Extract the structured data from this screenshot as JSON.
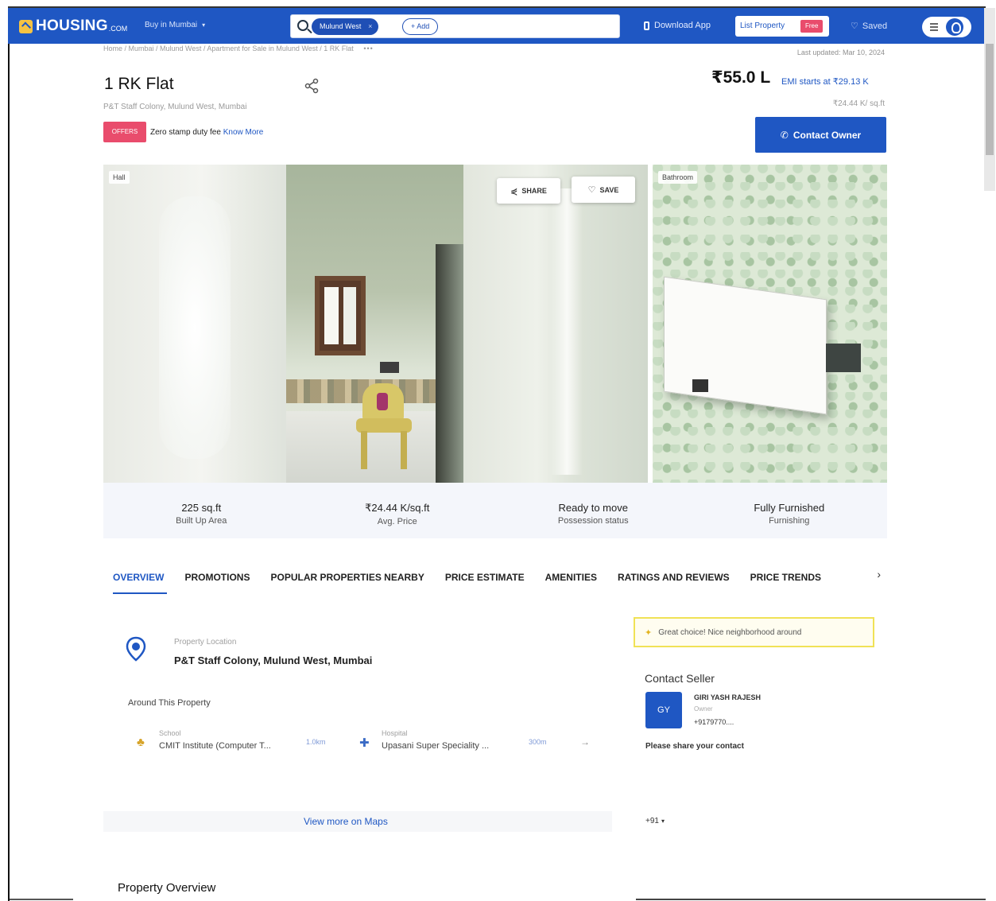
{
  "header": {
    "logo": "HOUSING",
    "logo_suffix": ".COM",
    "city_select": "Buy in Mumbai",
    "search_chip": "Mulund West",
    "search_chip_close": "×",
    "add_chip": "+ Add",
    "download_app": "Download App",
    "list_property": "List Property",
    "free_badge": "Free",
    "saved": "Saved",
    "brand_color": "#1f57c3"
  },
  "breadcrumb": {
    "path": "Home / Mumbai / Mulund West / Apartment for Sale in Mulund West / 1 RK Flat",
    "more": "•••",
    "last_updated": "Last updated: Mar 10, 2024"
  },
  "property": {
    "title": "1 RK Flat",
    "subtitle": "P&T Staff Colony, Mulund West, Mumbai",
    "offers_badge": "OFFERS",
    "offer_text": "Zero stamp duty fee",
    "offer_link": "Know More",
    "price": "₹55.0 L",
    "emi": "EMI starts at ₹29.13 K",
    "price_per_sqft": "₹24.44 K/ sq.ft",
    "contact_owner": "Contact Owner"
  },
  "gallery": {
    "label_hall": "Hall",
    "label_bathroom": "Bathroom",
    "share": "SHARE",
    "save": "SAVE"
  },
  "stats": [
    {
      "value": "225 sq.ft",
      "label": "Built Up Area"
    },
    {
      "value": "₹24.44 K/sq.ft",
      "label": "Avg. Price"
    },
    {
      "value": "Ready to move",
      "label": "Possession status"
    },
    {
      "value": "Fully Furnished",
      "label": "Furnishing"
    }
  ],
  "tabs": [
    "OVERVIEW",
    "PROMOTIONS",
    "POPULAR PROPERTIES NEARBY",
    "PRICE ESTIMATE",
    "AMENITIES",
    "RATINGS AND REVIEWS",
    "PRICE TRENDS"
  ],
  "location": {
    "label": "Property Location",
    "address": "P&T Staff Colony, Mulund West, Mumbai",
    "around": "Around This Property",
    "pois": [
      {
        "category": "School",
        "name": "CMIT Institute (Computer T...",
        "distance": "1.0km"
      },
      {
        "category": "Hospital",
        "name": "Upasani Super Speciality ...",
        "distance": "300m"
      }
    ],
    "view_maps": "View more on Maps"
  },
  "neighborhood": {
    "note": "Great choice! Nice neighborhood around"
  },
  "seller": {
    "title": "Contact Seller",
    "initials": "GY",
    "name": "GIRI YASH RAJESH",
    "role": "Owner",
    "phone": "+9179770....",
    "share_contact": "Please share your contact",
    "country_code": "+91"
  },
  "overview": {
    "title": "Property Overview"
  }
}
